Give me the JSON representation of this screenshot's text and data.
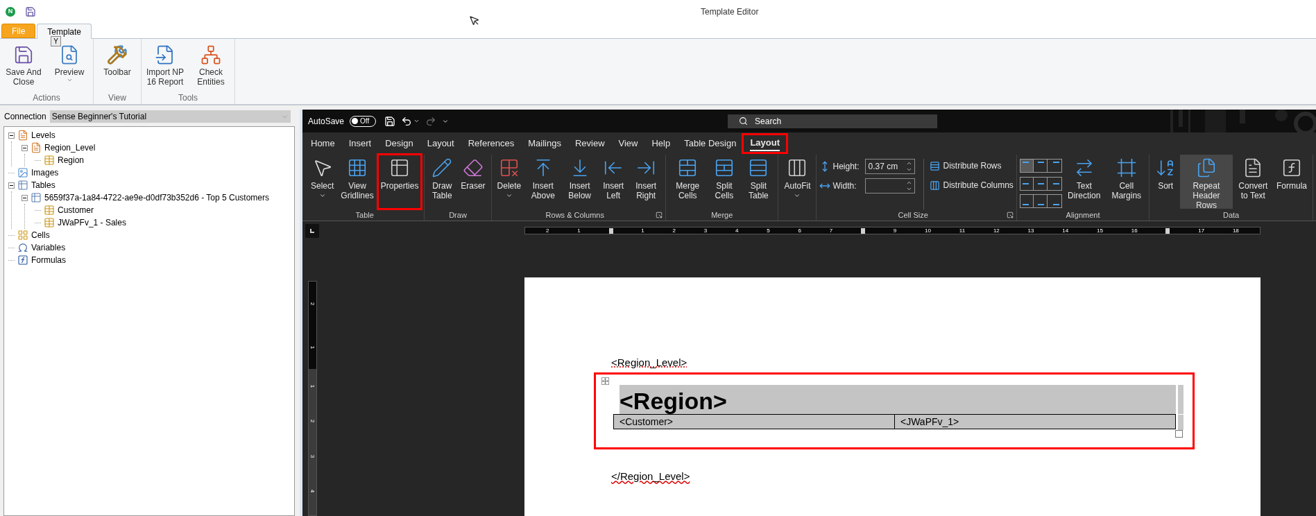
{
  "app": {
    "logo": "N",
    "title": "Template Editor"
  },
  "ribbon_tabs": [
    {
      "label": "File",
      "kind": "file",
      "selected": false
    },
    {
      "label": "Template",
      "kind": "tab",
      "selected": true,
      "key_tip": "Y"
    }
  ],
  "ribbon_groups": [
    {
      "label": "Actions",
      "buttons": [
        {
          "label": "Save And Close",
          "dropdown": false
        },
        {
          "label": "Preview",
          "dropdown": true
        }
      ]
    },
    {
      "label": "View",
      "buttons": [
        {
          "label": "Toolbar",
          "dropdown": false
        }
      ]
    },
    {
      "label": "Tools",
      "buttons": [
        {
          "label": "Import NP 16 Report",
          "dropdown": false
        },
        {
          "label": "Check Entities",
          "dropdown": false
        }
      ]
    }
  ],
  "connection": {
    "label": "Connection",
    "value": "Sense Beginner's Tutorial"
  },
  "tree": [
    {
      "label": "Levels",
      "kind": "level",
      "expanded": true,
      "children": [
        {
          "label": "Region_Level",
          "kind": "level",
          "expanded": true,
          "children": [
            {
              "label": "Region",
              "kind": "field"
            }
          ]
        }
      ]
    },
    {
      "label": "Images",
      "kind": "images"
    },
    {
      "label": "Tables",
      "kind": "table",
      "expanded": true,
      "children": [
        {
          "label": "5659f37a-1a84-4722-ae9e-d0df73b352d6 - Top 5 Customers",
          "kind": "table",
          "expanded": true,
          "children": [
            {
              "label": "Customer",
              "kind": "field"
            },
            {
              "label": "JWaPFv_1 - Sales",
              "kind": "field"
            }
          ]
        }
      ]
    },
    {
      "label": "Cells",
      "kind": "cells"
    },
    {
      "label": "Variables",
      "kind": "variables"
    },
    {
      "label": "Formulas",
      "kind": "formulas"
    }
  ],
  "word": {
    "autosave": {
      "label": "AutoSave",
      "state": "Off",
      "on": false
    },
    "search": {
      "placeholder": "Search"
    },
    "tabs": [
      {
        "label": "Home",
        "selected": false,
        "highlighted": false
      },
      {
        "label": "Insert",
        "selected": false,
        "highlighted": false
      },
      {
        "label": "Design",
        "selected": false,
        "highlighted": false
      },
      {
        "label": "Layout",
        "selected": false,
        "highlighted": false
      },
      {
        "label": "References",
        "selected": false,
        "highlighted": false
      },
      {
        "label": "Mailings",
        "selected": false,
        "highlighted": false
      },
      {
        "label": "Review",
        "selected": false,
        "highlighted": false
      },
      {
        "label": "View",
        "selected": false,
        "highlighted": false
      },
      {
        "label": "Help",
        "selected": false,
        "highlighted": false
      },
      {
        "label": "Table Design",
        "selected": false,
        "highlighted": false
      },
      {
        "label": "Layout",
        "selected": true,
        "highlighted": true
      }
    ],
    "groups": [
      {
        "label": "Table",
        "launcher": false,
        "items": [
          {
            "kind": "button",
            "label": "Select",
            "dropdown": true,
            "highlighted": false,
            "selected": false
          },
          {
            "kind": "button",
            "label": "View Gridlines",
            "dropdown": false,
            "highlighted": false,
            "selected": false
          },
          {
            "kind": "button",
            "label": "Properties",
            "dropdown": false,
            "highlighted": true,
            "selected": false
          }
        ]
      },
      {
        "label": "Draw",
        "launcher": false,
        "items": [
          {
            "kind": "button",
            "label": "Draw Table",
            "dropdown": false,
            "highlighted": false,
            "selected": false
          },
          {
            "kind": "button",
            "label": "Eraser",
            "dropdown": false,
            "highlighted": false,
            "selected": false
          }
        ]
      },
      {
        "label": "Rows & Columns",
        "launcher": true,
        "items": [
          {
            "kind": "button",
            "label": "Delete",
            "dropdown": true,
            "highlighted": false,
            "selected": false
          },
          {
            "kind": "button",
            "label": "Insert Above",
            "dropdown": false,
            "highlighted": false,
            "selected": false
          },
          {
            "kind": "button",
            "label": "Insert Below",
            "dropdown": false,
            "highlighted": false,
            "selected": false
          },
          {
            "kind": "button",
            "label": "Insert Left",
            "dropdown": false,
            "highlighted": false,
            "selected": false
          },
          {
            "kind": "button",
            "label": "Insert Right",
            "dropdown": false,
            "highlighted": false,
            "selected": false
          }
        ]
      },
      {
        "label": "Merge",
        "launcher": false,
        "items": [
          {
            "kind": "button",
            "label": "Merge Cells",
            "dropdown": false,
            "highlighted": false,
            "selected": false
          },
          {
            "kind": "button",
            "label": "Split Cells",
            "dropdown": false,
            "highlighted": false,
            "selected": false
          },
          {
            "kind": "button",
            "label": "Split Table",
            "dropdown": false,
            "highlighted": false,
            "selected": false
          }
        ]
      },
      {
        "launcher": false,
        "items": [
          {
            "kind": "button",
            "label": "AutoFit",
            "dropdown": true,
            "highlighted": false,
            "selected": false
          }
        ]
      },
      {
        "label": "Cell Size",
        "launcher": true,
        "items": [
          {
            "kind": "size",
            "fields": [
              {
                "label": "Height:",
                "value": "0.37 cm"
              },
              {
                "label": "Width:"
              }
            ],
            "buttons": [
              "Distribute Rows",
              "Distribute Columns"
            ]
          }
        ]
      },
      {
        "label": "Alignment",
        "launcher": false,
        "items": [
          {
            "kind": "align",
            "cells": [
              {
                "selected": true
              },
              {
                "selected": false
              },
              {
                "selected": false
              },
              {
                "selected": false
              },
              {
                "selected": false
              },
              {
                "selected": false
              },
              {
                "selected": false
              },
              {
                "selected": false
              },
              {
                "selected": false
              }
            ]
          },
          {
            "kind": "button",
            "label": "Text Direction",
            "dropdown": false,
            "highlighted": false,
            "selected": false
          },
          {
            "kind": "button",
            "label": "Cell Margins",
            "dropdown": false,
            "highlighted": false,
            "selected": false
          }
        ]
      },
      {
        "label": "Data",
        "launcher": false,
        "items": [
          {
            "kind": "button",
            "label": "Sort",
            "dropdown": false,
            "highlighted": false,
            "selected": false
          },
          {
            "kind": "button",
            "label": "Repeat Header Rows",
            "dropdown": false,
            "highlighted": false,
            "selected": true
          },
          {
            "kind": "button",
            "label": "Convert to Text",
            "dropdown": false,
            "highlighted": false,
            "selected": false
          },
          {
            "kind": "button",
            "label": "Formula",
            "dropdown": false,
            "highlighted": false,
            "selected": false
          }
        ]
      }
    ],
    "ruler": {
      "horizontal": [
        {
          "kind": "number",
          "text": "2"
        },
        {
          "kind": "number",
          "text": "1"
        },
        {
          "kind": "marker"
        },
        {
          "kind": "number",
          "text": "1"
        },
        {
          "kind": "number",
          "text": "2"
        },
        {
          "kind": "number",
          "text": "3"
        },
        {
          "kind": "number",
          "text": "4"
        },
        {
          "kind": "number",
          "text": "5"
        },
        {
          "kind": "number",
          "text": "6"
        },
        {
          "kind": "number",
          "text": "7"
        },
        {
          "kind": "marker"
        },
        {
          "kind": "number",
          "text": "9"
        },
        {
          "kind": "number",
          "text": "10"
        },
        {
          "kind": "number",
          "text": "11"
        },
        {
          "kind": "number",
          "text": "12"
        },
        {
          "kind": "number",
          "text": "13"
        },
        {
          "kind": "number",
          "text": "14"
        },
        {
          "kind": "number",
          "text": "15"
        },
        {
          "kind": "number",
          "text": "16"
        },
        {
          "kind": "marker"
        },
        {
          "kind": "number",
          "text": "17"
        },
        {
          "kind": "number",
          "text": "18"
        }
      ],
      "vertical": [
        "2",
        "1",
        "1",
        "2",
        "3",
        "4"
      ]
    },
    "document": {
      "opening_tag": "<Region_Level>",
      "table": {
        "highlighted": true,
        "header": "<Region>",
        "cells": [
          "<Customer>",
          "<JWaPFv_1>"
        ]
      },
      "closing_tag": "</Region_Level>"
    }
  }
}
